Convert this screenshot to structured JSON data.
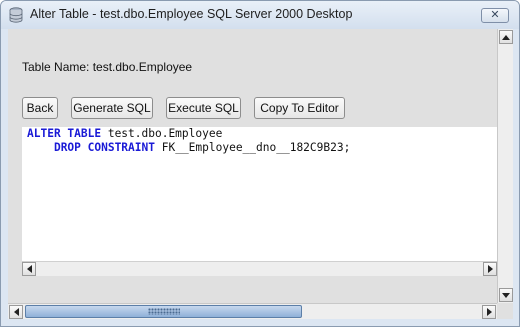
{
  "window": {
    "title": "Alter Table - test.dbo.Employee SQL Server 2000 Desktop",
    "close_glyph": "✕",
    "icon": "database-icon"
  },
  "table_name_label": "Table Name: test.dbo.Employee",
  "buttons": {
    "back": "Back",
    "generate_sql": "Generate SQL",
    "execute_sql": "Execute SQL",
    "copy_to_editor": "Copy To Editor"
  },
  "sql": {
    "line1": {
      "keyword": "ALTER TABLE",
      "rest": " test.dbo.Employee"
    },
    "line2": {
      "indent": "    ",
      "keyword": "DROP CONSTRAINT",
      "rest": " FK__Employee__dno__182C9B23;"
    }
  },
  "colors": {
    "keyword": "#1a1ad6",
    "scroll_thumb": "#8fb0d8"
  }
}
